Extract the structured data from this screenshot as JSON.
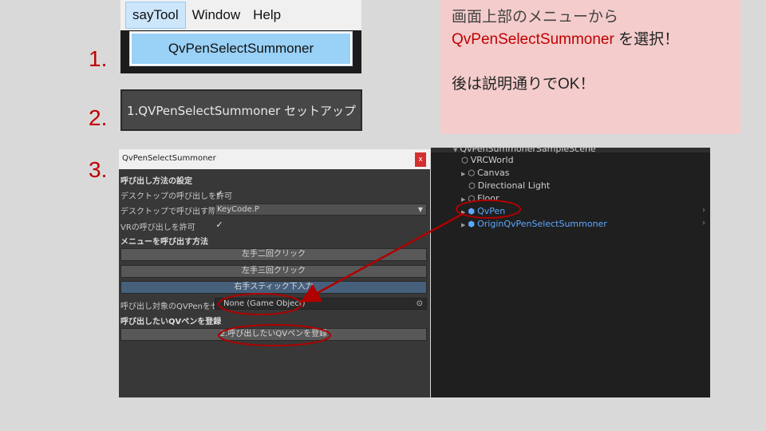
{
  "step_numbers": [
    "1.",
    "2.",
    "3."
  ],
  "menu": {
    "items": [
      "sayTool",
      "Window",
      "Help"
    ],
    "dropdown_item": "QvPenSelectSummoner"
  },
  "setup_button": "1.QVPenSelectSummoner セットアップ",
  "note": {
    "line1": "画面上部のメニューから",
    "line2_highlight": "QvPenSelectSummoner",
    "line2_rest": " を選択！",
    "line3": "後は説明通りでOK！"
  },
  "editor": {
    "title": "QvPenSelectSummoner",
    "close": "x",
    "section1": "呼び出し方法の設定",
    "allow_desktop": "デスクトップの呼び出しを許可",
    "desktop_key_label": "デスクトップで呼び出す際のKey",
    "desktop_key_value": "KeyCode.P",
    "allow_vr": "VRの呼び出しを許可",
    "section2": "メニューを呼び出す方法",
    "buttons": [
      "左手二回クリック",
      "左手三回クリック",
      "右手スティック下入力"
    ],
    "target_label": "呼び出し対象のQVPenをセット",
    "target_value": "None (Game Object)",
    "section3": "呼び出したいQVペンを登録",
    "register_button": "2.呼び出したいQVペンを登録",
    "checkmark": "✓",
    "dropdown_arrow": "▼",
    "target_icon": "⊙"
  },
  "hierarchy": {
    "scene": "QvPenSummonerSampleScene",
    "items": [
      "VRCWorld",
      "Canvas",
      "Directional Light",
      "Floor",
      "QvPen",
      "OriginQvPenSelectSummoner"
    ]
  },
  "colors": {
    "annotation_red": "#c00000",
    "note_bg": "#f4cccc",
    "menu_highlight": "#99d1f7",
    "prefab_blue": "#5fa8ff"
  }
}
